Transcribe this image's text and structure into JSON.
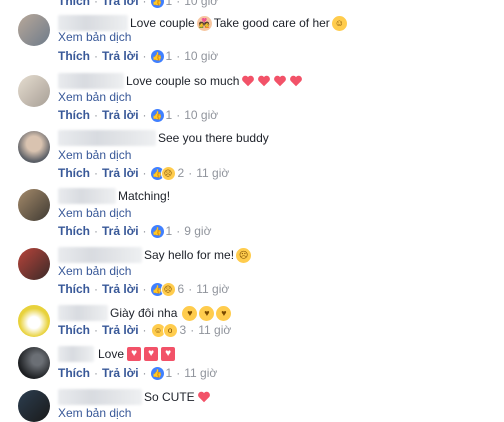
{
  "labels": {
    "translate": "Xem bản dịch",
    "like": "Thích",
    "reply": "Trả lời",
    "separator": "·"
  },
  "top_partial": {
    "like": "Thích",
    "reply": "Trả lời",
    "count": "1",
    "time": "10 giờ"
  },
  "comments": [
    {
      "text": "Love couple",
      "text2": "Take good care of her",
      "reactions": "1",
      "time": "10 giờ"
    },
    {
      "text": "Love couple so much",
      "reactions": "1",
      "time": "10 giờ"
    },
    {
      "text": "See you there buddy",
      "reactions": "2",
      "time": "11 giờ"
    },
    {
      "text": "Matching!",
      "reactions": "1",
      "time": "9 giờ"
    },
    {
      "text": "Say hello for me!",
      "reactions": "6",
      "time": "11 giờ"
    },
    {
      "text": "Giày đôi nha",
      "reactions": "3",
      "time": "11 giờ"
    },
    {
      "text": "Love",
      "reactions": "1",
      "time": "11 giờ"
    },
    {
      "text": "So CUTE"
    }
  ],
  "colors": {
    "link": "#385898",
    "meta": "#90949c",
    "like_blue": "#4080ff",
    "heart_red": "#f25268"
  },
  "icons": {
    "like": "like-icon",
    "haha": "haha-icon",
    "heart": "heart-icon",
    "kiss": "kiss-emoji-icon",
    "sad": "sad-emoji-icon",
    "smile": "smile-emoji-icon"
  }
}
